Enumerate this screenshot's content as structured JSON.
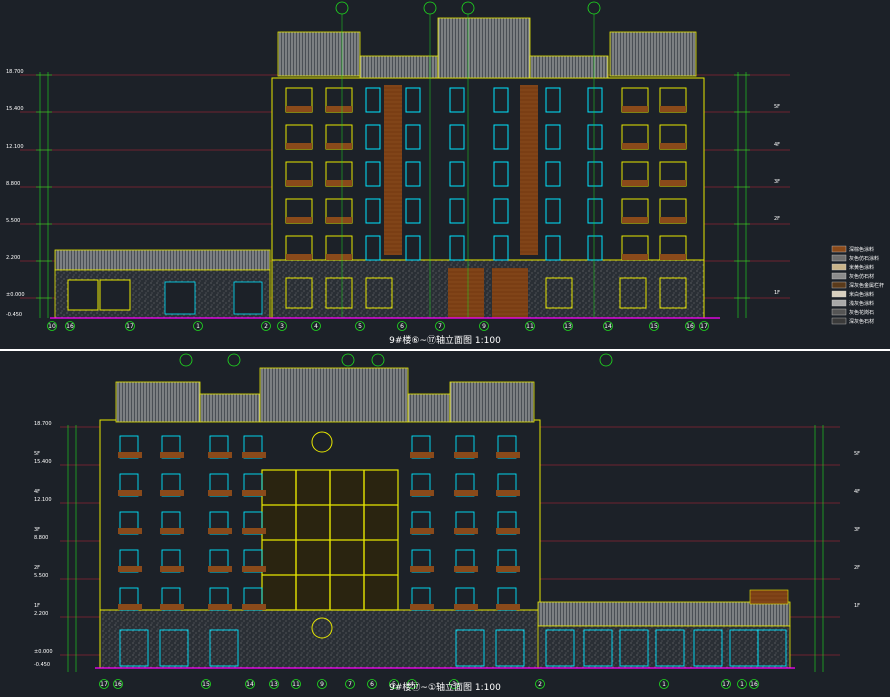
{
  "views": [
    {
      "id": "upper",
      "title": "9#楼⑥~⑰轴立面图",
      "scale": "1:100",
      "grid_axes": [
        "10",
        "16",
        "17",
        "1",
        "2",
        "3",
        "4",
        "5",
        "6",
        "7",
        "9",
        "11",
        "13",
        "14",
        "15",
        "16",
        "17"
      ],
      "levels_left": [
        "18.700",
        "15.400",
        "12.100",
        "8.800",
        "5.500",
        "2.200",
        "±0.000",
        "-0.450"
      ],
      "floors_right": [
        "5F",
        "4F",
        "3F",
        "2F",
        "1F"
      ]
    },
    {
      "id": "lower",
      "title": "9#楼⑰~①轴立面图",
      "scale": "1:100",
      "grid_axes": [
        "17",
        "16",
        "15",
        "14",
        "13",
        "11",
        "9",
        "7",
        "6",
        "5",
        "4",
        "3",
        "2",
        "1",
        "17",
        "1",
        "16"
      ],
      "levels_left": [
        "18.700",
        "15.400",
        "12.100",
        "8.800",
        "5.500",
        "2.200",
        "±0.000",
        "-0.450"
      ],
      "floors_left": [
        "5F",
        "4F",
        "3F",
        "2F",
        "1F"
      ],
      "floors_right": [
        "5F",
        "4F",
        "3F",
        "2F",
        "1F"
      ]
    }
  ],
  "legend": {
    "items": [
      {
        "label": "深棕色涂料",
        "color": "#8a4a1a"
      },
      {
        "label": "灰色仿石涂料",
        "color": "#6e6e6e"
      },
      {
        "label": "米黄色涂料",
        "color": "#c9b48a"
      },
      {
        "label": "灰色仿石材",
        "color": "#8c8c8c"
      },
      {
        "label": "深灰色金属栏杆",
        "color": "#5a3a1a"
      },
      {
        "label": "米白色涂料",
        "color": "#d8d0c0"
      },
      {
        "label": "浅灰色涂料",
        "color": "#a8a8a8"
      },
      {
        "label": "灰色花岗石",
        "color": "#555555"
      },
      {
        "label": "深灰色石材",
        "color": "#3a3a3a"
      }
    ]
  },
  "colors": {
    "background": "#1c2128",
    "structure": "#e6e600",
    "window": "#00e5ff",
    "brick": "#8a4a1a",
    "dim_red": "#c0283a",
    "axis_green": "#1fe01f",
    "magenta": "#ff00ff",
    "roof": "#bdbdbd"
  }
}
